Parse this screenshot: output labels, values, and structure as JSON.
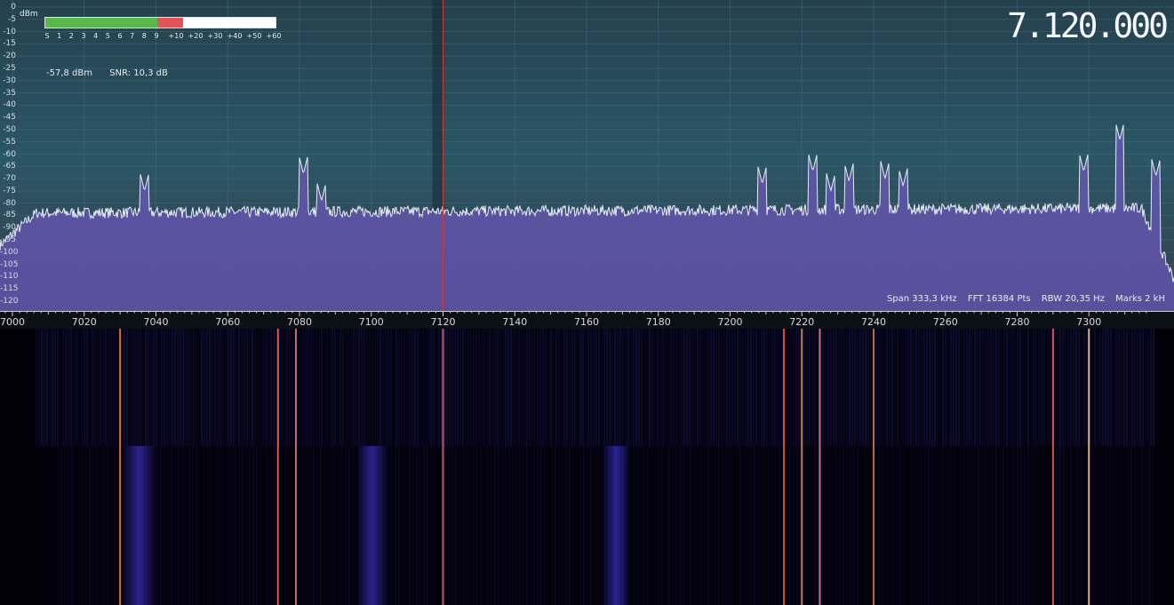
{
  "spectrum": {
    "dbm_unit": "dBm",
    "dbm_labels": [
      "0",
      "-5",
      "-10",
      "-15",
      "-20",
      "-25",
      "-30",
      "-35",
      "-40",
      "-45",
      "-50",
      "-55",
      "-60",
      "-65",
      "-70",
      "-75",
      "-80",
      "-85",
      "-90",
      "-95",
      "-100",
      "-105",
      "-110",
      "-115",
      "-120"
    ],
    "freq_labels": [
      "7000",
      "7020",
      "7040",
      "7060",
      "7080",
      "7100",
      "7120",
      "7140",
      "7160",
      "7180",
      "7200",
      "7220",
      "7240",
      "7260",
      "7280",
      "7300"
    ],
    "freq_range_khz": [
      6990,
      7315
    ],
    "db_range": [
      0,
      -123
    ],
    "noise_floor_dbm": -84,
    "tuned_khz": 7120,
    "peaks": [
      {
        "khz": 7030,
        "dbm": -75
      },
      {
        "khz": 7074,
        "dbm": -68
      },
      {
        "khz": 7079,
        "dbm": -79
      },
      {
        "khz": 7201,
        "dbm": -72
      },
      {
        "khz": 7215,
        "dbm": -67
      },
      {
        "khz": 7220,
        "dbm": -75
      },
      {
        "khz": 7225,
        "dbm": -71
      },
      {
        "khz": 7235,
        "dbm": -70
      },
      {
        "khz": 7240,
        "dbm": -73
      },
      {
        "khz": 7290,
        "dbm": -67
      },
      {
        "khz": 7300,
        "dbm": -54
      },
      {
        "khz": 7310,
        "dbm": -69
      }
    ],
    "colors": {
      "trace": "#e6eef6",
      "fill": "#5a4f9c",
      "grid": "#3f6a80",
      "tuning_line": "#d03a32"
    }
  },
  "smeter": {
    "scale_labels": [
      "S",
      "1",
      "2",
      "3",
      "4",
      "5",
      "6",
      "7",
      "8",
      "9",
      "+10",
      "+20",
      "+30",
      "+40",
      "+50",
      "+60"
    ],
    "s9_fraction": 0.485,
    "level_fraction": 0.6
  },
  "readout": {
    "level": "-57,8 dBm",
    "snr": "SNR: 10,3 dB"
  },
  "vfo": {
    "frequency": "7.120.000"
  },
  "fft_info": {
    "span": "Span 333,3 kHz",
    "fft": "FFT 16384 Pts",
    "rbw": "RBW 20,35 Hz",
    "marks": "Marks 2 kH"
  },
  "waterfall": {
    "bands": [
      {
        "khz": 7030,
        "strength": 0.9,
        "color": "#ff8a3a"
      },
      {
        "khz": 7074,
        "strength": 1.0,
        "color": "#ff6a5a"
      },
      {
        "khz": 7079,
        "strength": 0.7,
        "color": "#ff9a9a"
      },
      {
        "khz": 7120,
        "strength": 0.8,
        "color": "#c0a0ff"
      },
      {
        "khz": 7215,
        "strength": 0.9,
        "color": "#ff6a2a"
      },
      {
        "khz": 7220,
        "strength": 0.7,
        "color": "#ffb080"
      },
      {
        "khz": 7225,
        "strength": 0.8,
        "color": "#ff9ab0"
      },
      {
        "khz": 7240,
        "strength": 0.7,
        "color": "#ff9050"
      },
      {
        "khz": 7290,
        "strength": 0.9,
        "color": "#ff6a5a"
      },
      {
        "khz": 7300,
        "strength": 1.0,
        "color": "#ffd0a0"
      }
    ]
  }
}
